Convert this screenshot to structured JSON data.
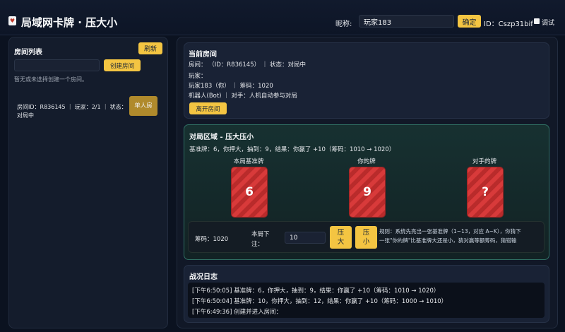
{
  "header": {
    "title": "局域网卡牌 · 压大小",
    "nickname_label": "昵称:",
    "nickname_value": "玩家183",
    "confirm_label": "确定",
    "user_id": "ID：Cszp31bif",
    "debug_label": "调试"
  },
  "rooms": {
    "title": "房间列表",
    "refresh_label": "刷新",
    "room_name_input": "",
    "create_label": "创建房间",
    "hint_line1": "暂无或未选择创建一个房间。",
    "hint_line2": "",
    "room_item": {
      "line1": "房间ID：R836145 ｜ 玩家：2/1 ｜ 状态：",
      "line2": "对局中",
      "join_label": "单人房"
    }
  },
  "current_room": {
    "title": "当前房间",
    "room_info": "房间：            （ID：R836145） ｜ 状态：对局中",
    "players_label": "玩家：",
    "player1": "玩家183（你）  ｜ 筹码：1020",
    "player2": "机器人(Bot) ｜ 对手：人机自动参与对局",
    "leave_label": "离开房间"
  },
  "game": {
    "title": "对局区域 - 压大压小",
    "result_text": "基准牌：6，你押大，抽到：9，结果：你赢了 +10（筹码：1010 → 1020）",
    "cards": [
      {
        "label": "本局基准牌",
        "value": "6"
      },
      {
        "label": "你的牌",
        "value": "9"
      },
      {
        "label": "对手的牌",
        "value": "?"
      }
    ],
    "chips_label": "筹码：1020",
    "bet_label_line1": "本局下",
    "bet_label_line2": "注：",
    "bet_value": "10",
    "big_label_1": "压",
    "big_label_2": "大",
    "small_label_1": "压",
    "small_label_2": "小",
    "rules_line1": "规则：系统先亮出一张基准牌（1~13，对应 A~K），你猜下",
    "rules_line2": "一张\"你的牌\"比基准牌大还是小，猜对赢等额筹码，猜错输"
  },
  "log": {
    "title": "战况日志",
    "entries": [
      "[下午6:50:05] 基准牌：6，你押大，抽到：9，结果：你赢了 +10（筹码：1010 → 1020）",
      "[下午6:50:04] 基准牌：10，你押大，抽到：12，结果：你赢了 +10（筹码：1000 → 1010）",
      "[下午6:49:36] 创建并进入房间："
    ]
  },
  "colors": {
    "accent": "#f4c542",
    "card_red": "#d83a3a",
    "game_border": "#2f6f63",
    "background": "#0b1220"
  }
}
